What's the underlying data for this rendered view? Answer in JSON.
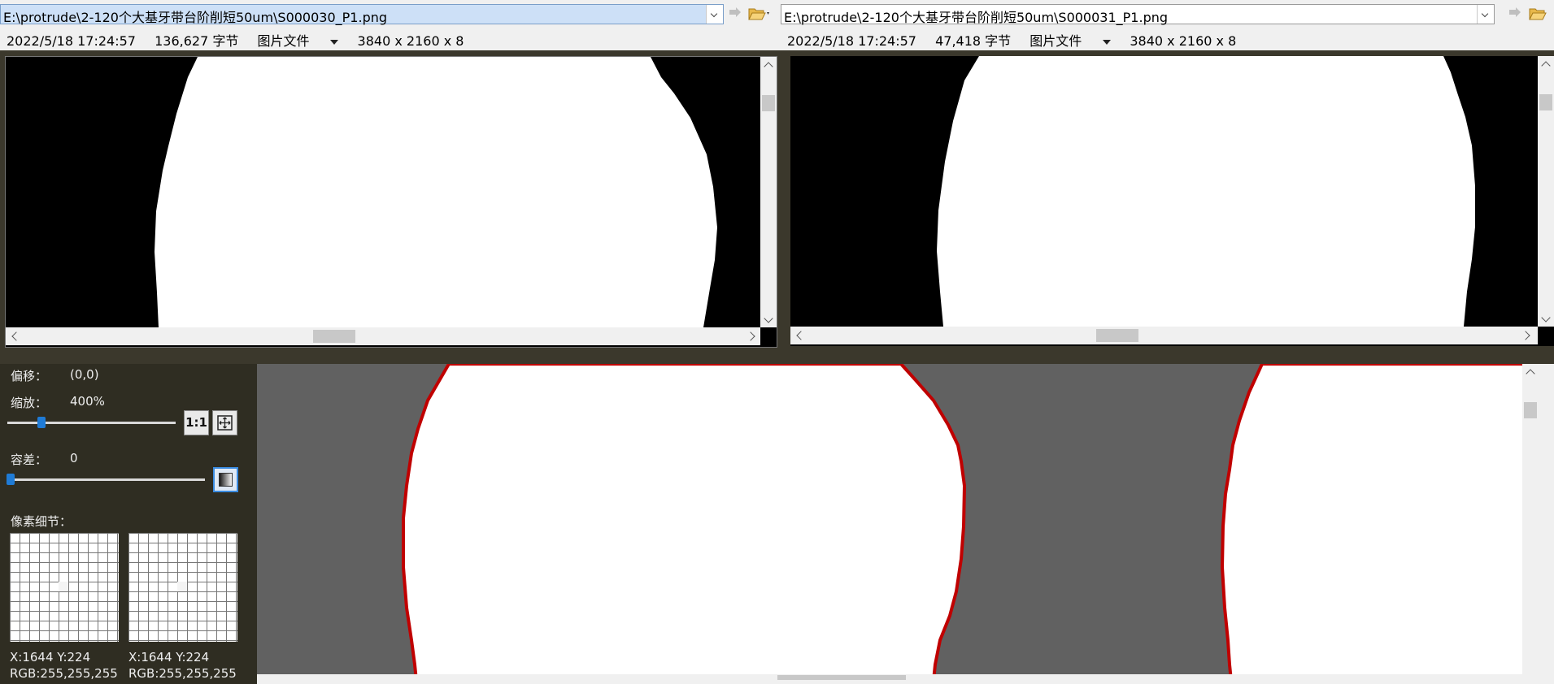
{
  "left_file": {
    "path": "E:\\protrude\\2-120个大基牙带台阶削短50um\\S000030_P1.png",
    "date": "2022/5/18 17:24:57",
    "size": "136,627 字节",
    "type": "图片文件",
    "dims": "3840 x 2160 x 8"
  },
  "right_file": {
    "path": "E:\\protrude\\2-120个大基牙带台阶削短50um\\S000031_P1.png",
    "date": "2022/5/18 17:24:57",
    "size": "47,418 字节",
    "type": "图片文件",
    "dims": "3840 x 2160 x 8"
  },
  "controls": {
    "offset_label": "偏移：",
    "offset_value": "(0,0)",
    "zoom_label": "缩放：",
    "zoom_value": "400%",
    "zoom_level_fraction": 0.2,
    "btn_1to1": "1:1",
    "tolerance_label": "容差：",
    "tolerance_value": "0",
    "tolerance_fraction": 0.0,
    "pixel_detail_label": "像素细节："
  },
  "pixel_left": {
    "coords": "X:1644 Y:224",
    "rgb": "RGB:255,255,255"
  },
  "pixel_right": {
    "coords": "X:1644 Y:224",
    "rgb": "RGB:255,255,255"
  },
  "colors": {
    "diff_gray": "#616161",
    "diff_edge": "#cc0000",
    "panel_bg": "#2f2d22",
    "accent": "#1f7bd6"
  },
  "icons": [
    "dropdown-icon",
    "next-diff-icon",
    "open-folder-icon",
    "fit-to-window-icon",
    "gradient-icon"
  ]
}
